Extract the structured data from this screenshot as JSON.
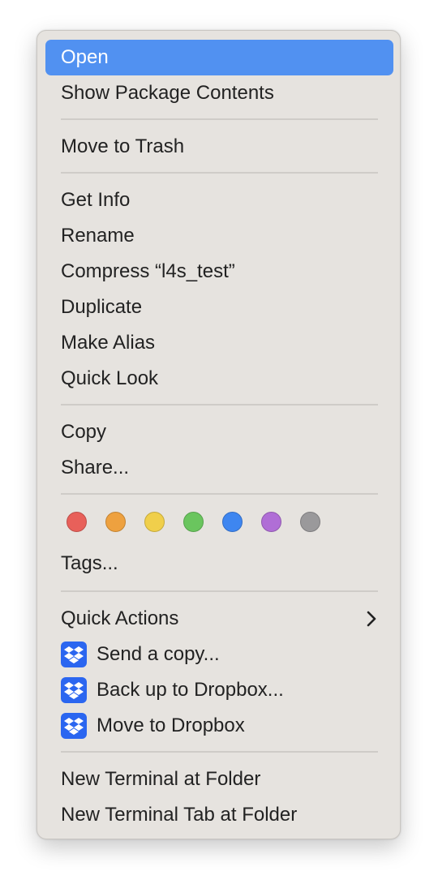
{
  "menu": {
    "items": {
      "open": "Open",
      "show_package_contents": "Show Package Contents",
      "move_to_trash": "Move to Trash",
      "get_info": "Get Info",
      "rename": "Rename",
      "compress": "Compress “l4s_test”",
      "duplicate": "Duplicate",
      "make_alias": "Make Alias",
      "quick_look": "Quick Look",
      "copy": "Copy",
      "share": "Share...",
      "tags": "Tags...",
      "quick_actions": "Quick Actions",
      "send_a_copy": "Send a copy...",
      "back_up_to_dropbox": "Back up to Dropbox...",
      "move_to_dropbox": "Move to Dropbox",
      "new_terminal_at_folder": "New Terminal at Folder",
      "new_terminal_tab_at_folder": "New Terminal Tab at Folder"
    },
    "highlighted_item": "open",
    "tag_colors": {
      "red": "#e8605a",
      "orange": "#eea13f",
      "yellow": "#f0cf4b",
      "green": "#6ac55e",
      "blue": "#3e86f0",
      "purple": "#b06ed6",
      "gray": "#9a999b"
    },
    "icons": {
      "quick_actions_indicator": "chevron-right-icon",
      "dropbox": "dropbox-icon"
    },
    "accent_color": "#5191f1",
    "dropbox_color": "#2b66f0"
  }
}
